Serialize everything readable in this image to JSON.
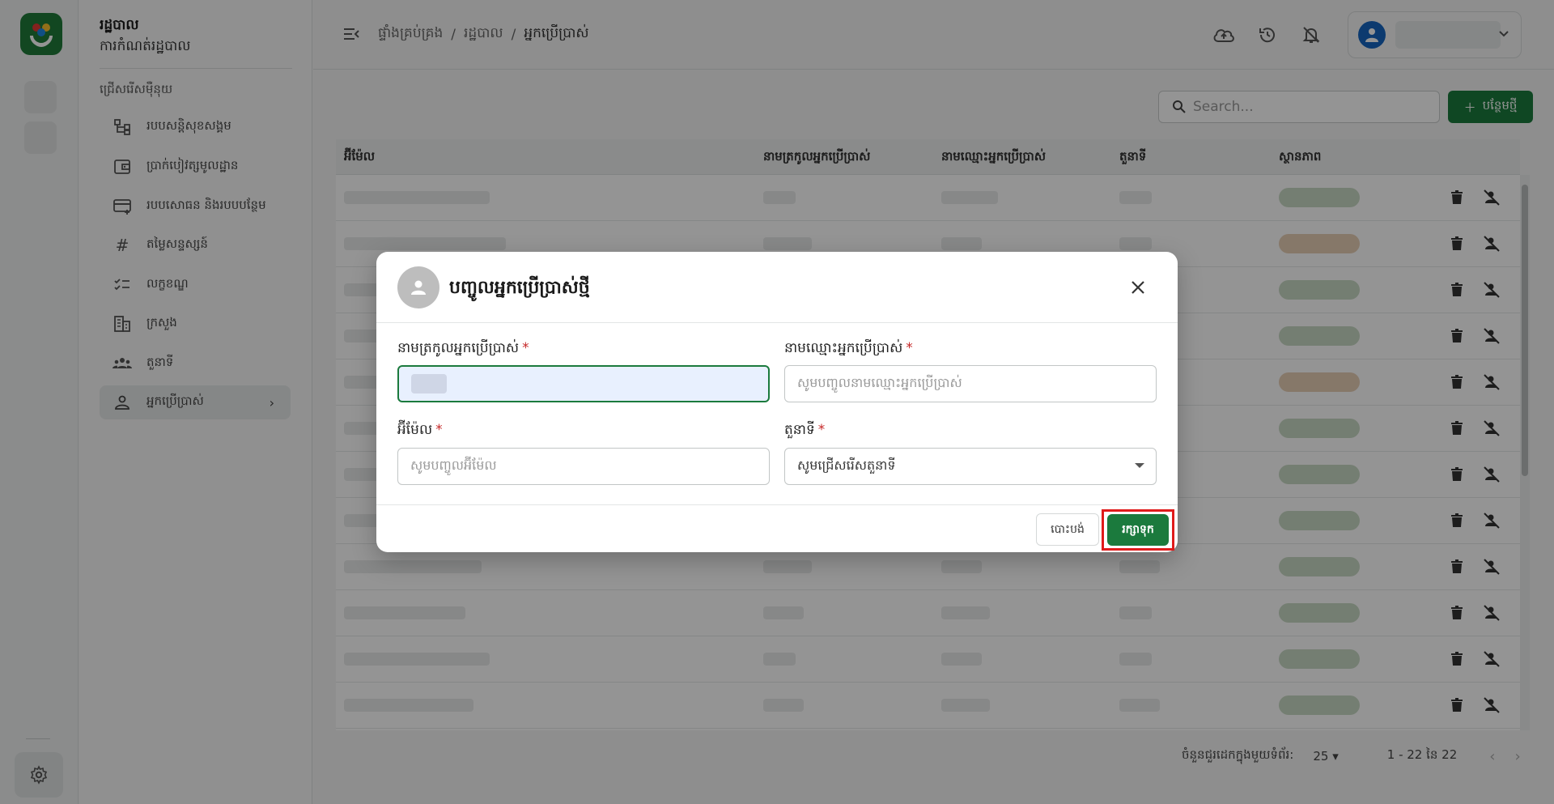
{
  "sidebar": {
    "title": "រដ្ឋបាល",
    "subtitle": "ការកំណត់រដ្ឋបាល",
    "section": "ជ្រើសរើសម៉ឺនុយ",
    "items": [
      {
        "label": "របបសន្តិសុខសង្គម",
        "icon": "hierarchy-icon"
      },
      {
        "label": "ប្រាក់បៀវត្សមូលដ្ឋាន",
        "icon": "wallet-icon"
      },
      {
        "label": "របបសោធន និងរបបបន្ថែម",
        "icon": "card-add-icon"
      },
      {
        "label": "តម្លៃសន្ទស្សន៍",
        "icon": "hash-icon"
      },
      {
        "label": "លក្ខខណ្ឌ",
        "icon": "checklist-icon"
      },
      {
        "label": "ក្រសួង",
        "icon": "building-icon"
      },
      {
        "label": "តួនាទី",
        "icon": "group-icon"
      },
      {
        "label": "អ្នកប្រើប្រាស់",
        "icon": "person-icon",
        "active": true
      }
    ]
  },
  "header": {
    "breadcrumb": [
      "ផ្ទាំងគ្រប់គ្រង",
      "/",
      "រដ្ឋបាល",
      "/",
      "អ្នកប្រើប្រាស់"
    ]
  },
  "toolbar": {
    "search_placeholder": "Search...",
    "add_label": "បន្ថែមថ្មី"
  },
  "table": {
    "columns": [
      "អ៊ីម៉ែល",
      "នាមត្រកូលអ្នកប្រើប្រាស់",
      "នាមឈ្មោះអ្នកប្រើប្រាស់",
      "តួនាទី",
      "ស្ថានភាព"
    ],
    "row_count": 12,
    "status_colors": [
      "#c9d9c4",
      "#e7cfb6",
      "#c9d9c4",
      "#c9d9c4",
      "#e7cfb6",
      "#c9d9c4",
      "#c9d9c4",
      "#c9d9c4",
      "#c9d9c4",
      "#c9d9c4",
      "#c9d9c4",
      "#c9d9c4"
    ]
  },
  "pagination": {
    "rows_per_page_label": "ចំនួនជួរដេកក្នុងមួយទំព័រ:",
    "rows_per_page": "25",
    "range": "1 - 22 នៃ 22"
  },
  "modal": {
    "title": "បញ្ចូលអ្នកប្រើប្រាស់ថ្មី",
    "fields": {
      "last_name_label": "នាមត្រកូលអ្នកប្រើប្រាស់",
      "first_name_label": "នាមឈ្មោះអ្នកប្រើប្រាស់",
      "first_name_placeholder": "សូមបញ្ចូលនាមឈ្មោះអ្នកប្រើប្រាស់",
      "email_label": "អ៊ីម៉ែល",
      "email_placeholder": "សូមបញ្ចូលអ៊ីម៉ែល",
      "role_label": "តួនាទី",
      "role_placeholder": "សូមជ្រើសរើសតួនាទី",
      "required_mark": "*"
    },
    "cancel_label": "បោះបង់",
    "save_label": "រក្សាទុក"
  },
  "colors": {
    "brand": "#1b7a3d",
    "highlight": "#e01b1b",
    "required": "#c62828"
  }
}
